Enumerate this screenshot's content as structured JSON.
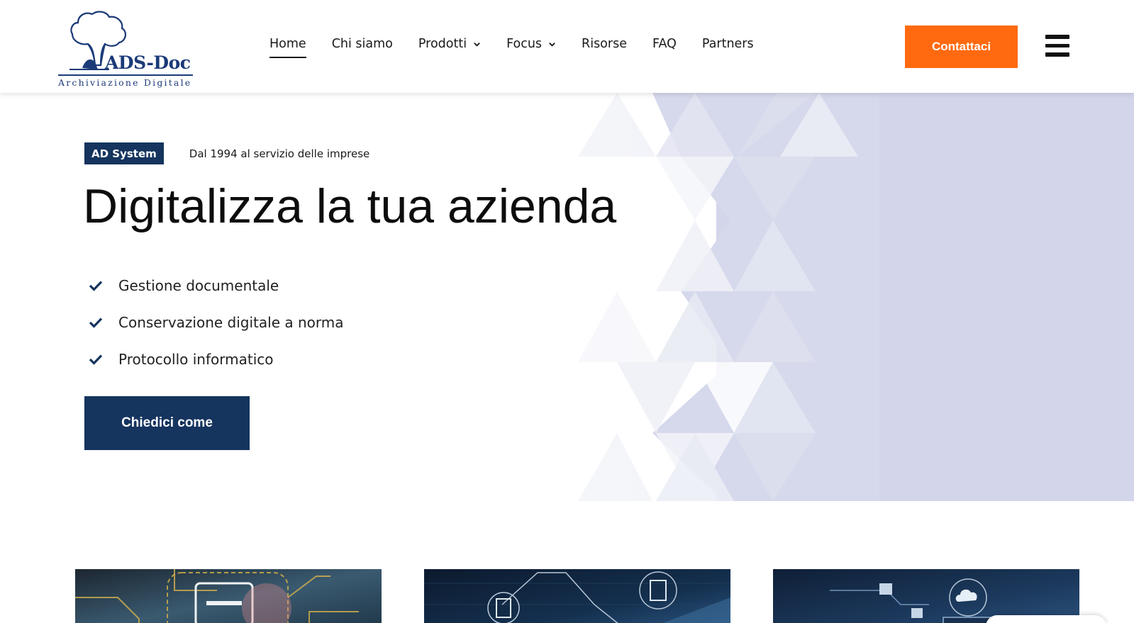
{
  "brand": {
    "name": "ADS-Doc",
    "tagline": "Archiviazione Digitale",
    "icon": "tree-logo-icon"
  },
  "nav": {
    "items": [
      {
        "label": "Home",
        "active": true
      },
      {
        "label": "Chi siamo"
      },
      {
        "label": "Prodotti",
        "dropdown": true
      },
      {
        "label": "Focus",
        "dropdown": true
      },
      {
        "label": "Risorse"
      },
      {
        "label": "FAQ"
      },
      {
        "label": "Partners"
      }
    ],
    "cta_label": "Contattaci",
    "menu_icon": "hamburger-menu-icon"
  },
  "hero": {
    "tag": "AD System",
    "tag_subtitle": "Dal 1994 al servizio delle imprese",
    "title": "Digitalizza la tua azienda",
    "features": [
      "Gestione documentale",
      "Conservazione digitale a norma",
      "Protocollo informatico"
    ],
    "button_label": "Chiedici come"
  },
  "cards": [
    {
      "image": "printer-document-circuit-image"
    },
    {
      "image": "documents-network-laptop-image"
    },
    {
      "image": "cloud-folders-tablet-image"
    }
  ],
  "colors": {
    "primary_navy": "#15345e",
    "accent_orange": "#ff6a10",
    "hero_lavender": "#d3d6ea"
  }
}
